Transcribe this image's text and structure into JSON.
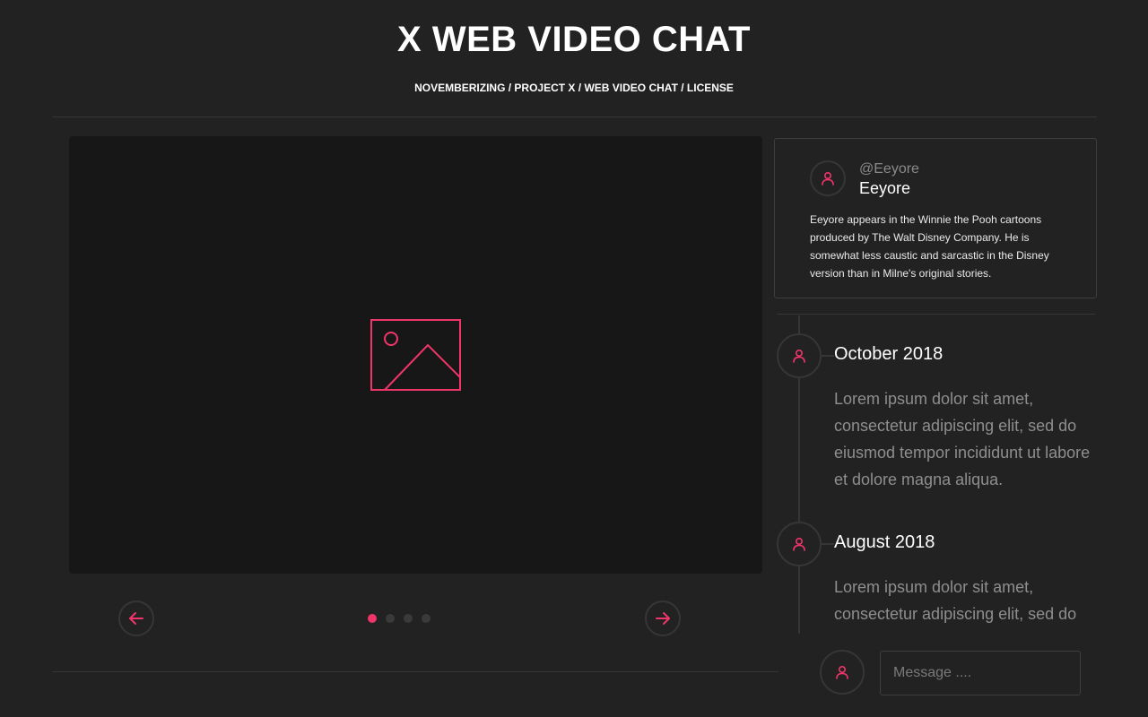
{
  "header": {
    "title": "X WEB VIDEO CHAT",
    "breadcrumb": [
      "NOVEMBERIZING",
      "PROJECT X",
      "WEB VIDEO CHAT",
      "LICENSE"
    ],
    "separator": " / "
  },
  "colors": {
    "accent": "#f0356a",
    "background": "#222222",
    "panel": "#171717",
    "border": "#363636"
  },
  "media": {
    "icon": "image-placeholder-icon"
  },
  "carousel": {
    "prev_icon": "arrow-left-icon",
    "next_icon": "arrow-right-icon",
    "slide_count": 4,
    "active_index": 0
  },
  "profile": {
    "handle": "@Eeyore",
    "name": "Eeyore",
    "bio": "Eeyore appears in the Winnie the Pooh cartoons produced by The Walt Disney Company. He is somewhat less caustic and sarcastic in the Disney version than in Milne's original stories.",
    "icon": "user-icon"
  },
  "timeline": [
    {
      "date": "October 2018",
      "text": "Lorem ipsum dolor sit amet, consectetur adipiscing elit, sed do eiusmod tempor incididunt ut labore et dolore magna aliqua."
    },
    {
      "date": "August 2018",
      "text": "Lorem ipsum dolor sit amet, consectetur adipiscing elit, sed do eiusmod tempor incididunt ut labore et dolore magna aliqua."
    }
  ],
  "composer": {
    "placeholder": "Message ....",
    "value": ""
  }
}
